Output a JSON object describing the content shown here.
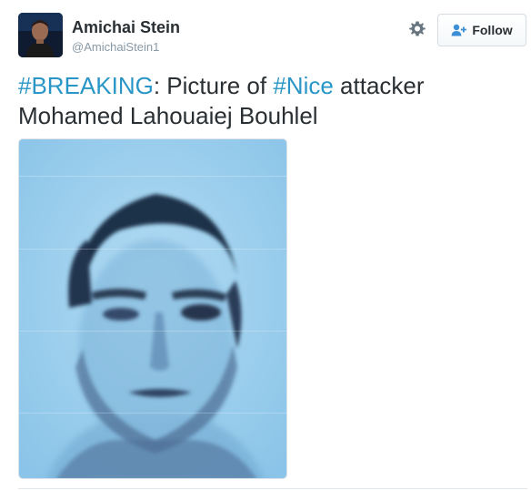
{
  "author": {
    "display_name": "Amichai Stein",
    "handle": "@AmichaiStein1"
  },
  "actions": {
    "follow_label": "Follow"
  },
  "tweet": {
    "hashtag_1": "#BREAKING",
    "text_1": ": Picture of ",
    "hashtag_2": "#Nice",
    "text_2": " attacker Mohamed Lahouaiej Bouhlel"
  },
  "colors": {
    "hashtag": "#2a96c7",
    "follow_icon": "#3a8fd6",
    "photo_background": "#9fd0ef"
  },
  "icons": {
    "settings": "gear-icon",
    "follow": "person-add-icon"
  }
}
